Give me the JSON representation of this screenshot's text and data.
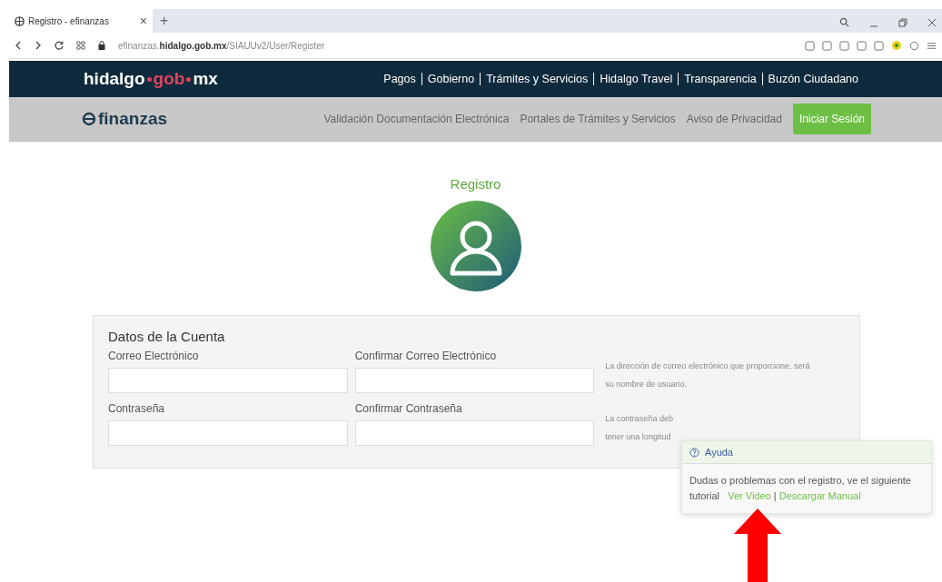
{
  "browser": {
    "tab": {
      "title": "Registro - efinanzas",
      "close": "×"
    },
    "new_tab": "+",
    "url": {
      "prefix": "efinanzas.",
      "domain": "hidalgo.gob.mx",
      "path": "/SIAUUv2/User/Register"
    }
  },
  "top_nav": {
    "logo": {
      "part1": "hidalgo",
      "part2": "gob",
      "part3": "mx"
    },
    "items": [
      "Pagos",
      "Gobierno",
      "Trámites y Servicios",
      "Hidalgo Travel",
      "Transparencia",
      "Buzón Ciudadano"
    ]
  },
  "sub_nav": {
    "logo": "finanzas",
    "items": [
      "Validación Documentación Electrónica",
      "Portales de Trámites y Servicios",
      "Aviso de Privacidad"
    ],
    "login_button": "Iniciar Sesión"
  },
  "title": "Registro",
  "panel": {
    "heading": "Datos de la Cuenta",
    "rows": [
      {
        "fields": [
          {
            "label": "Correo Electrónico"
          },
          {
            "label": "Confirmar Correo Electrónico"
          }
        ],
        "hint": [
          "La dirección de correo electrónico que proporcione, será",
          "su nombre de usuario."
        ]
      },
      {
        "fields": [
          {
            "label": "Contraseña"
          },
          {
            "label": "Confirmar Contraseña"
          }
        ],
        "hint": [
          "La contraseña deb",
          "tener una longitud"
        ]
      }
    ]
  },
  "help": {
    "title": "Ayuda",
    "text": "Dudas o problemas con el registro, ve el siguiente tutorial",
    "links": [
      "Ver Video",
      "Descargar Manual"
    ],
    "separator": "|"
  }
}
